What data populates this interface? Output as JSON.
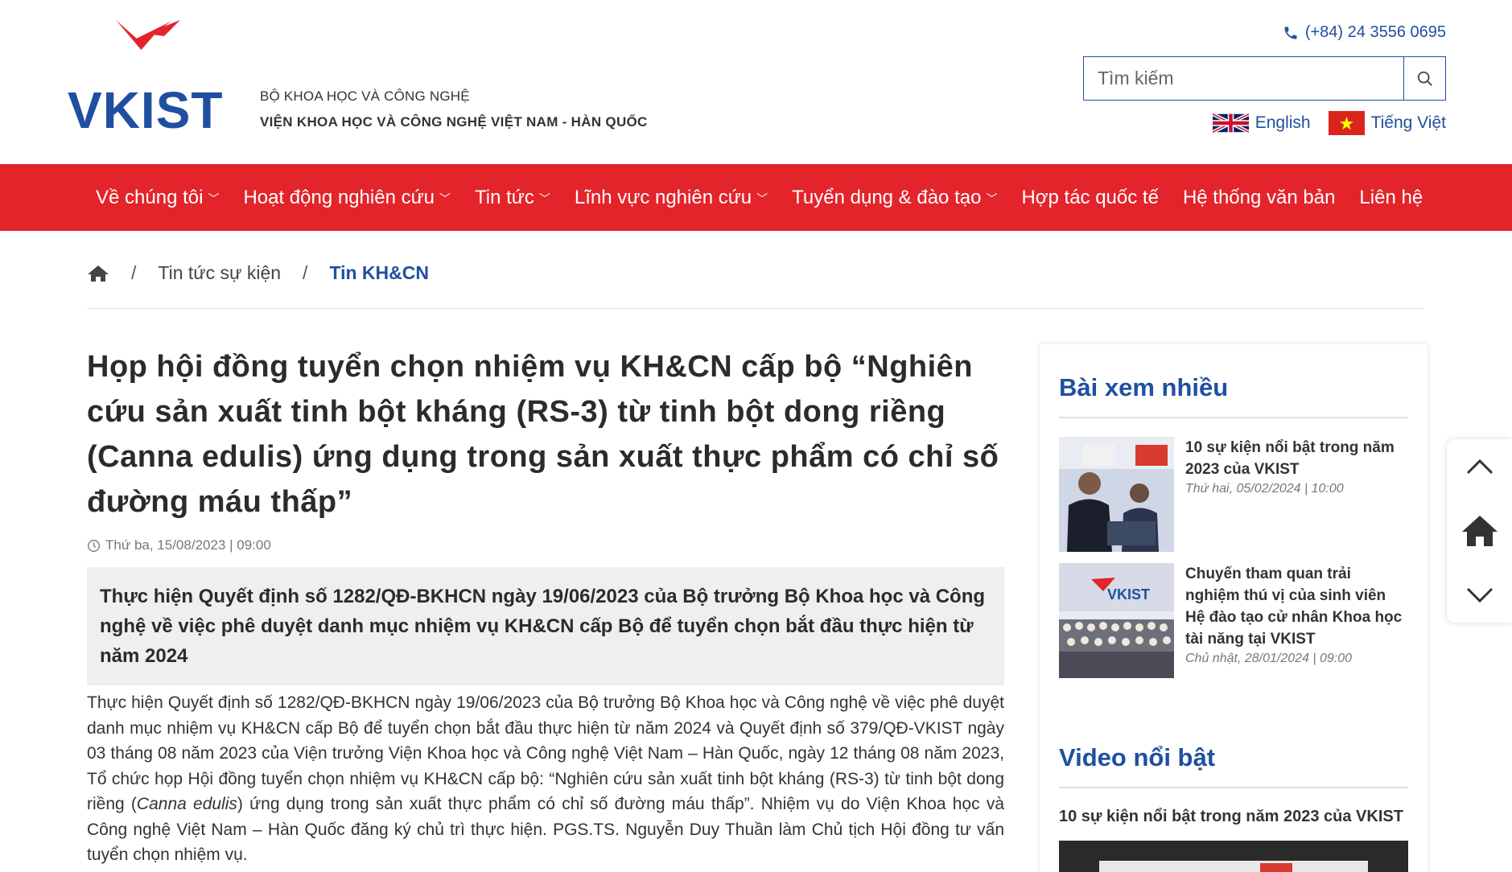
{
  "header": {
    "logo_text": "VKIST",
    "org_sub": "BỘ KHOA HỌC VÀ CÔNG NGHỆ",
    "org_main": "VIỆN KHOA HỌC VÀ CÔNG NGHỆ VIỆT NAM - HÀN QUỐC",
    "phone": "(+84) 24 3556 0695",
    "search_placeholder": "Tìm kiếm",
    "languages": [
      "English",
      "Tiếng Việt"
    ]
  },
  "nav": {
    "items": [
      {
        "label": "Về chúng tôi",
        "dropdown": true
      },
      {
        "label": "Hoạt động nghiên cứu",
        "dropdown": true
      },
      {
        "label": "Tin tức",
        "dropdown": true
      },
      {
        "label": "Lĩnh vực nghiên cứu",
        "dropdown": true
      },
      {
        "label": "Tuyển dụng & đào tạo",
        "dropdown": true
      },
      {
        "label": "Hợp tác quốc tế",
        "dropdown": false
      },
      {
        "label": "Hệ thống văn bản",
        "dropdown": false
      },
      {
        "label": "Liên hệ",
        "dropdown": false
      }
    ]
  },
  "breadcrumb": {
    "items": [
      "Tin tức sự kiện",
      "Tin KH&CN"
    ]
  },
  "article": {
    "title": "Họp hội đồng tuyển chọn nhiệm vụ KH&CN cấp bộ “Nghiên cứu sản xuất tinh bột kháng (RS-3) từ tinh bột dong riềng (Canna edulis) ứng dụng trong sản xuất thực phẩm có chỉ số đường máu thấp”",
    "date": "Thứ ba, 15/08/2023 | 09:00",
    "lead": "Thực hiện Quyết định số 1282/QĐ-BKHCN ngày 19/06/2023 của Bộ trưởng Bộ Khoa học và Công nghệ về việc phê duyệt danh mục nhiệm vụ KH&CN cấp Bộ để tuyển chọn bắt đầu thực hiện từ năm 2024",
    "body_part1": "Thực hiện Quyết định số 1282/QĐ-BKHCN ngày 19/06/2023 của Bộ trưởng Bộ Khoa học và Công nghệ về việc phê duyệt danh mục nhiệm vụ KH&CN cấp Bộ để tuyển chọn bắt đầu thực hiện từ năm 2024 và Quyết định số 379/QĐ-VKIST ngày 03 tháng 08 năm 2023 của Viện trưởng Viện Khoa học và Công nghệ Việt Nam – Hàn Quốc, ngày 12 tháng 08 năm 2023, Tổ chức họp Hội đồng tuyển chọn nhiệm vụ KH&CN cấp bộ: “Nghiên cứu sản xuất tinh bột kháng (RS-3) từ tinh bột dong riềng (",
    "body_italic": "Canna edulis",
    "body_part2": ") ứng dụng trong sản xuất thực phẩm có chỉ số đường máu thấp”. Nhiệm vụ do Viện Khoa học và Công nghệ Việt Nam – Hàn Quốc đăng ký chủ trì thực hiện. PGS.TS. Nguyễn Duy Thuần làm Chủ tịch Hội đồng tư vấn tuyển chọn nhiệm vụ."
  },
  "sidebar": {
    "popular_heading": "Bài xem nhiều",
    "popular": [
      {
        "title": "10 sự kiện nổi bật trong năm 2023 của VKIST",
        "date": "Thứ hai, 05/02/2024 | 10:00"
      },
      {
        "title": "Chuyến tham quan trải nghiệm thú vị của sinh viên Hệ đào tạo cử nhân Khoa học tài năng tại VKIST",
        "date": "Chủ nhật, 28/01/2024 | 09:00"
      }
    ],
    "video_heading": "Video nổi bật",
    "video_title": "10 sự kiện nổi bật trong năm 2023 của VKIST"
  },
  "colors": {
    "brand_red": "#e3242b",
    "brand_blue": "#1f4fa0"
  }
}
